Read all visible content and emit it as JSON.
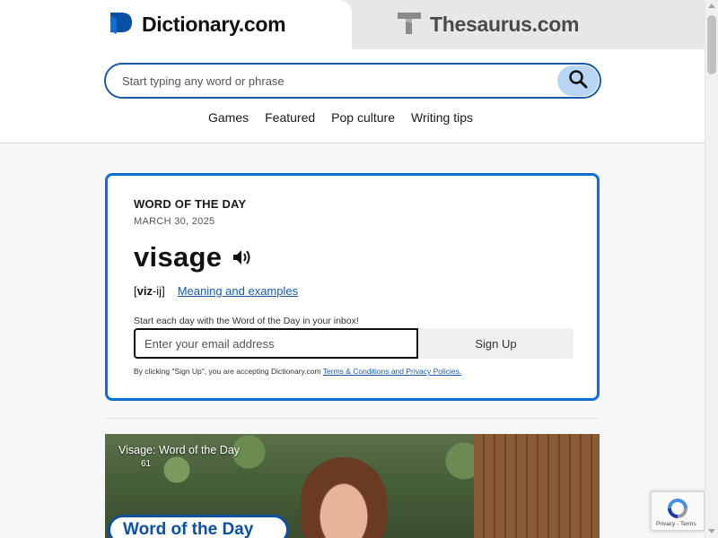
{
  "header": {
    "tab_dictionary": "Dictionary.com",
    "tab_thesaurus": "Thesaurus.com",
    "search_placeholder": "Start typing any word or phrase",
    "nav": [
      "Games",
      "Featured",
      "Pop culture",
      "Writing tips"
    ]
  },
  "word_of_the_day": {
    "label": "WORD OF THE DAY",
    "date": "MARCH 30, 2025",
    "word": "visage",
    "pronunciation_prefix": "[",
    "pronunciation_stressed": "viz",
    "pronunciation_rest": "-ij]",
    "meaning_link": "Meaning and examples",
    "prompt": "Start each day with the Word of the Day in your inbox!",
    "email_placeholder": "Enter your email address",
    "signup_label": "Sign Up",
    "terms_prefix": "By clicking \"Sign Up\", you are accepting Dictionary.com ",
    "terms_link": "Terms & Conditions and Privacy Policies."
  },
  "video": {
    "title": "Visage: Word of the Day",
    "subtitle": "61",
    "badge": "Word of the Day"
  },
  "recaptcha": {
    "terms": "Privacy - Terms"
  },
  "colors": {
    "brand_blue": "#0b6fd6",
    "search_border": "#1a5aa6",
    "search_button": "#b8d6f3"
  }
}
